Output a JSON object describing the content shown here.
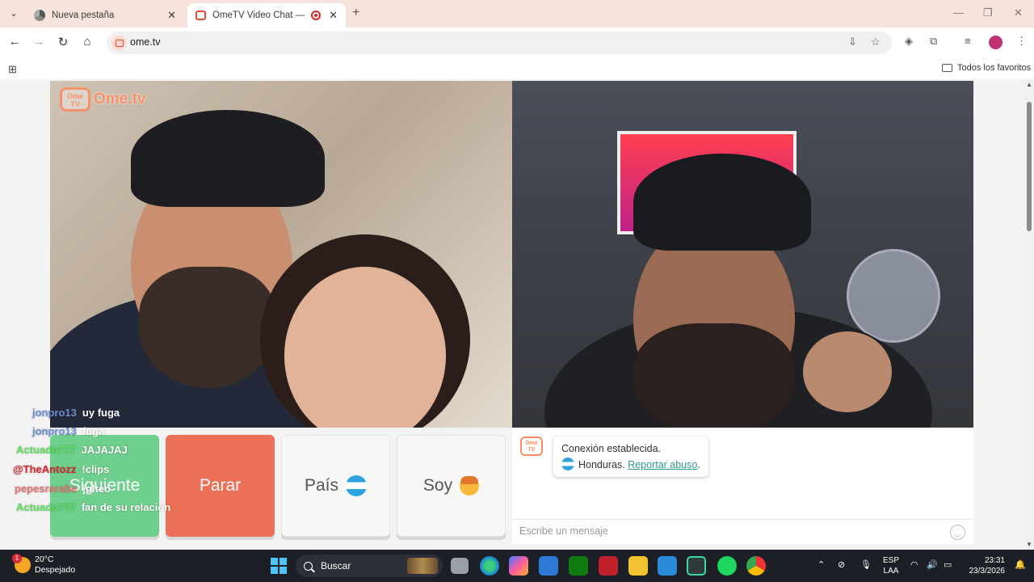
{
  "browser": {
    "tabs": [
      {
        "title": "Nueva pestaña",
        "active": false
      },
      {
        "title": "OmeTV Video Chat — Ome",
        "active": true,
        "recording": true
      }
    ],
    "url": "ome.tv",
    "bookmarks_label": "Todos los favoritos"
  },
  "video": {
    "logo_text": "Ome.tv",
    "logo_badge": "Ome TV"
  },
  "controls": {
    "next_label": "Siguiente",
    "stop_label": "Parar",
    "country_label": "País",
    "gender_label": "Soy"
  },
  "chat": {
    "system_line1": "Conexión establecida.",
    "country_name": "Honduras.",
    "report_link": "Reportar abuso",
    "report_suffix": ".",
    "placeholder": "Escribe un mensaje"
  },
  "stream_overlay": [
    {
      "user": "jonpro13",
      "msg": "uy fuga",
      "color": "#6f8fd0"
    },
    {
      "user": "jonpro13",
      "msg": "fuga",
      "color": "#6f8fd0"
    },
    {
      "user": "Actuado777",
      "msg": "JAJAJAJ",
      "color": "#5de05d"
    },
    {
      "user": "@TheAntozz",
      "msg": "!clips",
      "color": "#d8262e"
    },
    {
      "user": "pepesrarabe",
      "msg": "jolteo",
      "color": "#e57373"
    },
    {
      "user": "Actuado777",
      "msg": "fan de su relación",
      "color": "#5de05d"
    }
  ],
  "taskbar": {
    "temperature": "20°C",
    "weather": "Despejado",
    "weather_badge": "1",
    "search_label": "Buscar",
    "lang_line1": "ESP",
    "lang_line2": "LAA",
    "time": "23:31",
    "date": "23/3/2026"
  }
}
